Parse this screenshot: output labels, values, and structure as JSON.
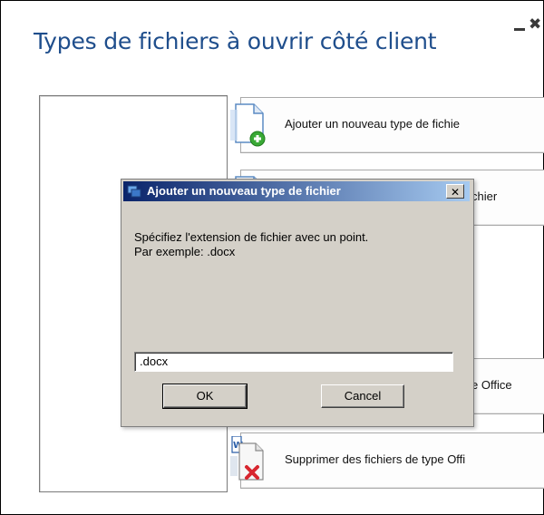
{
  "window": {
    "title": "Types de fichiers à ouvrir côté client",
    "minimize_icon": "minimize-icon",
    "close_icon": "close-icon"
  },
  "actions": [
    {
      "label": "Ajouter un nouveau type de fichie",
      "icon": "document-add-icon"
    },
    {
      "label": "chier",
      "icon": "document-icon"
    },
    {
      "label": "e Office",
      "icon": "document-icon"
    },
    {
      "label": "Supprimer des fichiers de type Offi",
      "icon": "document-delete-icon"
    }
  ],
  "dialog": {
    "title": "Ajouter un nouveau type de fichier",
    "close_label": "✕",
    "message_line1": "Spécifiez l'extension de fichier avec un point.",
    "message_line2": "Par exemple: .docx",
    "input_value": ".docx",
    "ok_label": "OK",
    "cancel_label": "Cancel"
  },
  "colors": {
    "title_blue": "#1f4e8c",
    "dialog_gray": "#d4d0c8",
    "titlebar_start": "#0a246a",
    "titlebar_end": "#a6caf0",
    "add_green": "#39a935",
    "delete_red": "#d8262f"
  }
}
